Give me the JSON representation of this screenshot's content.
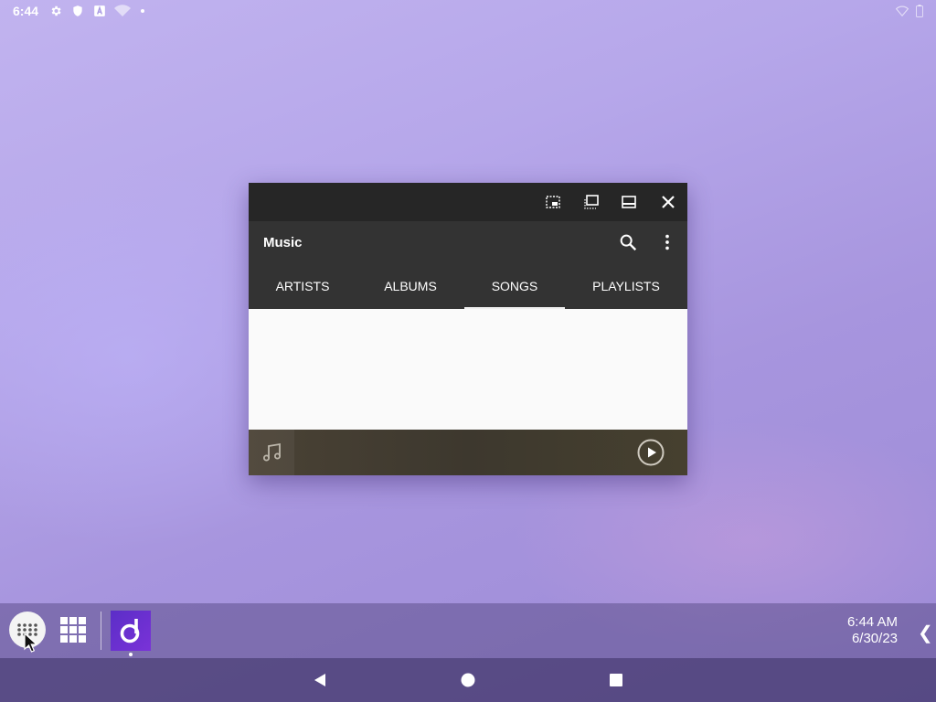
{
  "status_bar": {
    "time": "6:44",
    "icons": [
      "settings-icon",
      "shield-icon",
      "a-icon",
      "wifi-off-icon",
      "dot-icon"
    ],
    "right_icons": [
      "wifi-icon",
      "battery-icon"
    ]
  },
  "window": {
    "controls": [
      "pip-icon",
      "restore-icon",
      "maximize-icon",
      "close-icon"
    ],
    "app_title": "Music",
    "actions": [
      "search-icon",
      "more-vert-icon"
    ],
    "tabs": [
      {
        "label": "ARTISTS",
        "active": false
      },
      {
        "label": "ALBUMS",
        "active": false
      },
      {
        "label": "SONGS",
        "active": true
      },
      {
        "label": "PLAYLISTS",
        "active": false
      }
    ],
    "now_playing": {
      "art_icon": "music-note-icon",
      "control_icon": "play-circle-icon"
    }
  },
  "taskbar": {
    "pinned": [
      "all-apps-icon",
      "grid-icon",
      "music-app-icon"
    ],
    "clock_time": "6:44 AM",
    "clock_date": "6/30/23",
    "collapse_glyph": "❮"
  },
  "navbar": {
    "buttons": [
      "back-icon",
      "home-icon",
      "recents-icon"
    ]
  },
  "colors": {
    "titlebar": "#262626",
    "appbar": "#333333",
    "accent_app": "#6a2fd0"
  }
}
